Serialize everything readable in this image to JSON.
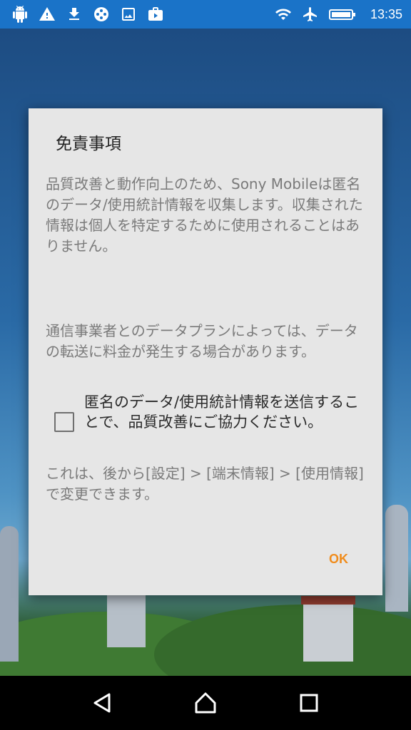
{
  "status_bar": {
    "time": "13:35",
    "left_icons": [
      "android-icon",
      "warning-icon",
      "download-icon",
      "film-reel-icon",
      "image-icon",
      "briefcase-icon"
    ],
    "right_icons": [
      "wifi-icon",
      "airplane-icon",
      "battery-icon"
    ]
  },
  "dialog": {
    "title": "免責事項",
    "paragraph1": "品質改善と動作向上のため、Sony Mobileは匿名のデータ/使用統計情報を収集します。収集された情報は個人を特定するために使用されることはありません。",
    "paragraph2": "通信事業者とのデータプランによっては、データの転送に料金が発生する場合があります。",
    "checkbox_label": "匿名のデータ/使用統計情報を送信することで、品質改善にご協力ください。",
    "checkbox_checked": false,
    "paragraph3": "これは、後から[設定] > [端末情報] > [使用情報]で変更できます。",
    "ok_label": "OK"
  },
  "colors": {
    "status_bar": "#1a73c8",
    "dialog_bg": "#e6e6e6",
    "accent": "#f08c1c",
    "secondary_text": "#7a7a7a"
  },
  "nav_bar": {
    "buttons": [
      "back-icon",
      "home-icon",
      "recents-icon"
    ]
  }
}
